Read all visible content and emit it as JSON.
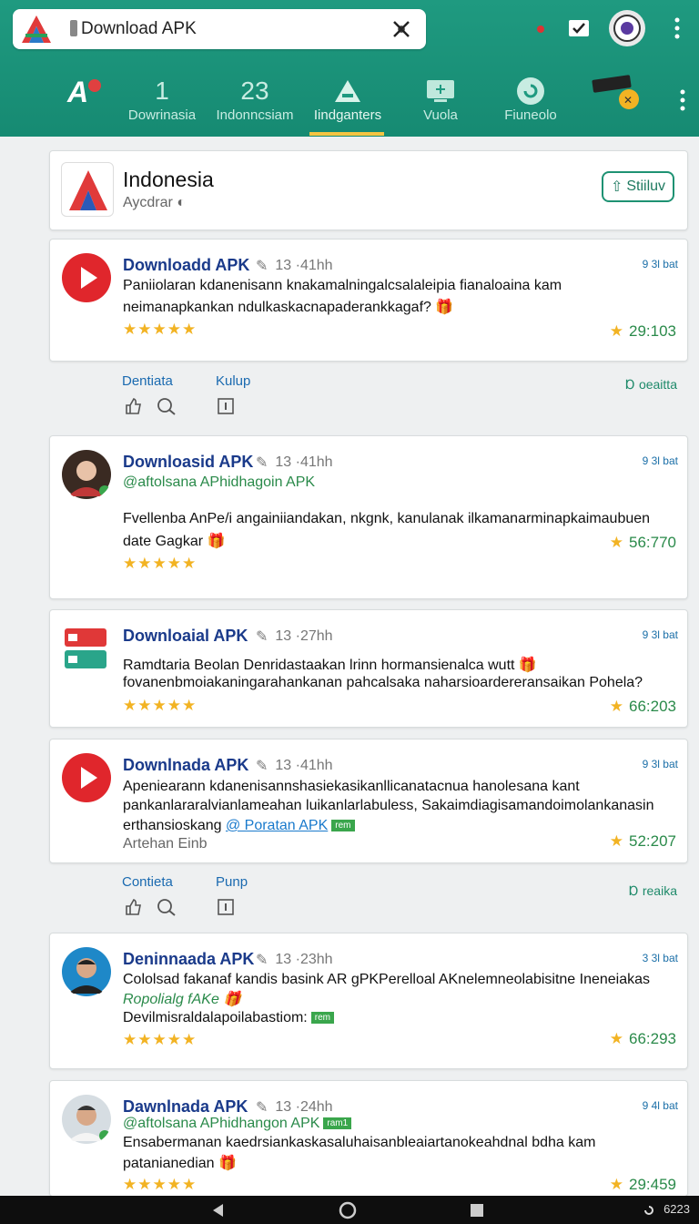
{
  "colors": {
    "brand": "#168a72",
    "accent": "#f5c542",
    "link": "#1a6ab0",
    "title": "#1a3a8a",
    "green": "#2a8a4a"
  },
  "search": {
    "text": "Download APK"
  },
  "tabs": [
    {
      "icon": "app-logo-icon",
      "label": "Dowrinasia",
      "num": "1"
    },
    {
      "icon": "numbers-icon",
      "label": "Indonncsiam",
      "num": "23"
    },
    {
      "icon": "triangle-icon",
      "label": "Iindganters"
    },
    {
      "icon": "screen-icon",
      "label": "Vuola"
    },
    {
      "icon": "refresh-icon",
      "label": "Fiuneolo"
    },
    {
      "icon": "device-icon",
      "label": ""
    }
  ],
  "header": {
    "title": "Indonesia",
    "subtitle": "Aycdrar",
    "button": "Stiiluv"
  },
  "posts": [
    {
      "title": "Downloadd APK",
      "time": "13 ·41hh",
      "badge": "9 3l bat",
      "lines": [
        "Paniiolaran kdanenisann knakamalningalcsalaleipia fianaloaina kam",
        "neimanapkankan ndulkaskacnapaderankkagaf? 🎁"
      ],
      "count": "29:103"
    },
    {
      "title": "Downloasid APK",
      "time": "13 ·41hh",
      "badge": "9 3l bat",
      "handle": "@aftolsana APhidhagoin APK",
      "lines": [
        "Fvellenba AnPe/i angainiiandakan, nkgnk, kanulanak ilkamanarminapkaimaubuen",
        "date Gagkar 🎁"
      ],
      "count": "56:770"
    },
    {
      "title": "Downloaial APK",
      "time": "13 ·27hh",
      "badge": "9 3l bat",
      "lines": [
        "Ramdtaria Beolan Denridastaakan lrinn hormansienalca wutt 🎁",
        "fovanenbmoiakaningarahankanan pahcalsaka naharsioardereransaikan Pohela?"
      ],
      "count": "66:203"
    },
    {
      "title": "Downlnada APK",
      "time": "13 ·41hh",
      "badge": "9 3l bat",
      "lines": [
        "Apeniearann kdanenisannshasiekasikanllicanatacnua hanolesana kant",
        "pankanlararalvianlameahan luikanlarlabuless, Sakaimdiagisamandoimolankanasin",
        "erthansioskang"
      ],
      "link": "@ Poratan APK",
      "chip": "rem",
      "sub": "Artehan Einb",
      "count": "52:207"
    },
    {
      "title": "Deninnaada APK",
      "time": "13 ·23hh",
      "badge": "3 3l bat",
      "lines": [
        "Cololsad fakanaf kandis basink AR gPKPerelloal AKnelemneolabisitne Ineneiakas"
      ],
      "handle": "Ropolialg fAKe 🎁",
      "line3": "Devilmisraldalapoilabastiom:",
      "chip": "rem",
      "count": "66:293"
    },
    {
      "title": "Dawnlnada APK",
      "time": "13 ·24hh",
      "badge": "9 4l bat",
      "handle": "@aftolsana APhidhangon APK",
      "chip": "ram1",
      "lines": [
        "Ensabermanan kaedrsiankaskasaluhaisanbleaiartanokeahdnal bdha kam",
        "patanianedian 🎁"
      ],
      "count": "29:459"
    }
  ],
  "actions": [
    {
      "a": "Dentiata",
      "b": "Kulup",
      "c": "Ɒ oeaitta"
    },
    {
      "a": "Contieta",
      "b": "Punp",
      "c": "Ɒ reaika"
    }
  ],
  "stars": "★★★★★",
  "system": {
    "time": "6223"
  }
}
